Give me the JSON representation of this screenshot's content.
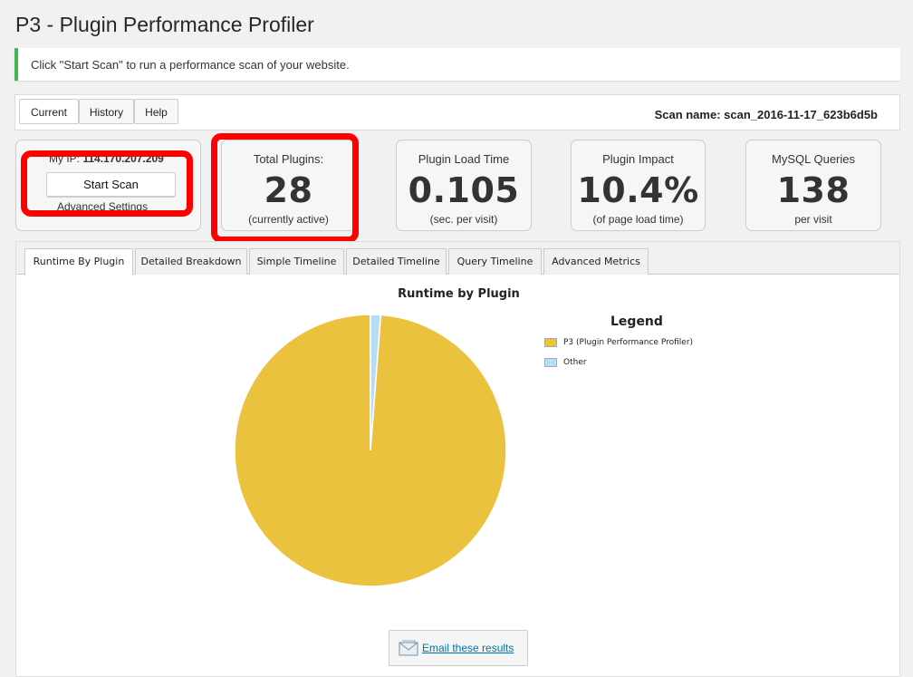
{
  "page": {
    "title": "P3 - Plugin Performance Profiler"
  },
  "notice": {
    "text": "Click \"Start Scan\" to run a performance scan of your website."
  },
  "nav": {
    "tabs": [
      {
        "label": "Current",
        "active": true
      },
      {
        "label": "History",
        "active": false
      },
      {
        "label": "Help",
        "active": false
      }
    ],
    "scan_name": "Scan name: scan_2016-11-17_623b6d5b"
  },
  "scan_box": {
    "ip_label": "My IP:",
    "ip_value": "114.170.207.209",
    "start_button": "Start Scan",
    "advanced": "Advanced Settings"
  },
  "stats": [
    {
      "label": "Total Plugins:",
      "value": "28",
      "sub": "(currently active)"
    },
    {
      "label": "Plugin Load Time",
      "value": "0.105",
      "sub": "(sec. per visit)"
    },
    {
      "label": "Plugin Impact",
      "value": "10.4%",
      "sub": "(of page load time)"
    },
    {
      "label": "MySQL Queries",
      "value": "138",
      "sub": "per visit"
    }
  ],
  "results_tabs": [
    {
      "label": "Runtime By Plugin",
      "active": true
    },
    {
      "label": "Detailed Breakdown",
      "active": false
    },
    {
      "label": "Simple Timeline",
      "active": false
    },
    {
      "label": "Detailed Timeline",
      "active": false
    },
    {
      "label": "Query Timeline",
      "active": false
    },
    {
      "label": "Advanced Metrics",
      "active": false
    }
  ],
  "chart_data": {
    "type": "pie",
    "title": "Runtime by Plugin",
    "legend_title": "Legend",
    "legend_position": "right",
    "slices": [
      {
        "label": "P3 (Plugin Performance Profiler)",
        "value": 98.8,
        "color": "#ebc23e"
      },
      {
        "label": "Other",
        "value": 1.2,
        "color": "#b7dcf5"
      }
    ]
  },
  "email": {
    "label": "Email these results"
  },
  "colors": {
    "notice_border": "#46b450",
    "highlight": "#ff0000",
    "link": "#0073aa"
  }
}
